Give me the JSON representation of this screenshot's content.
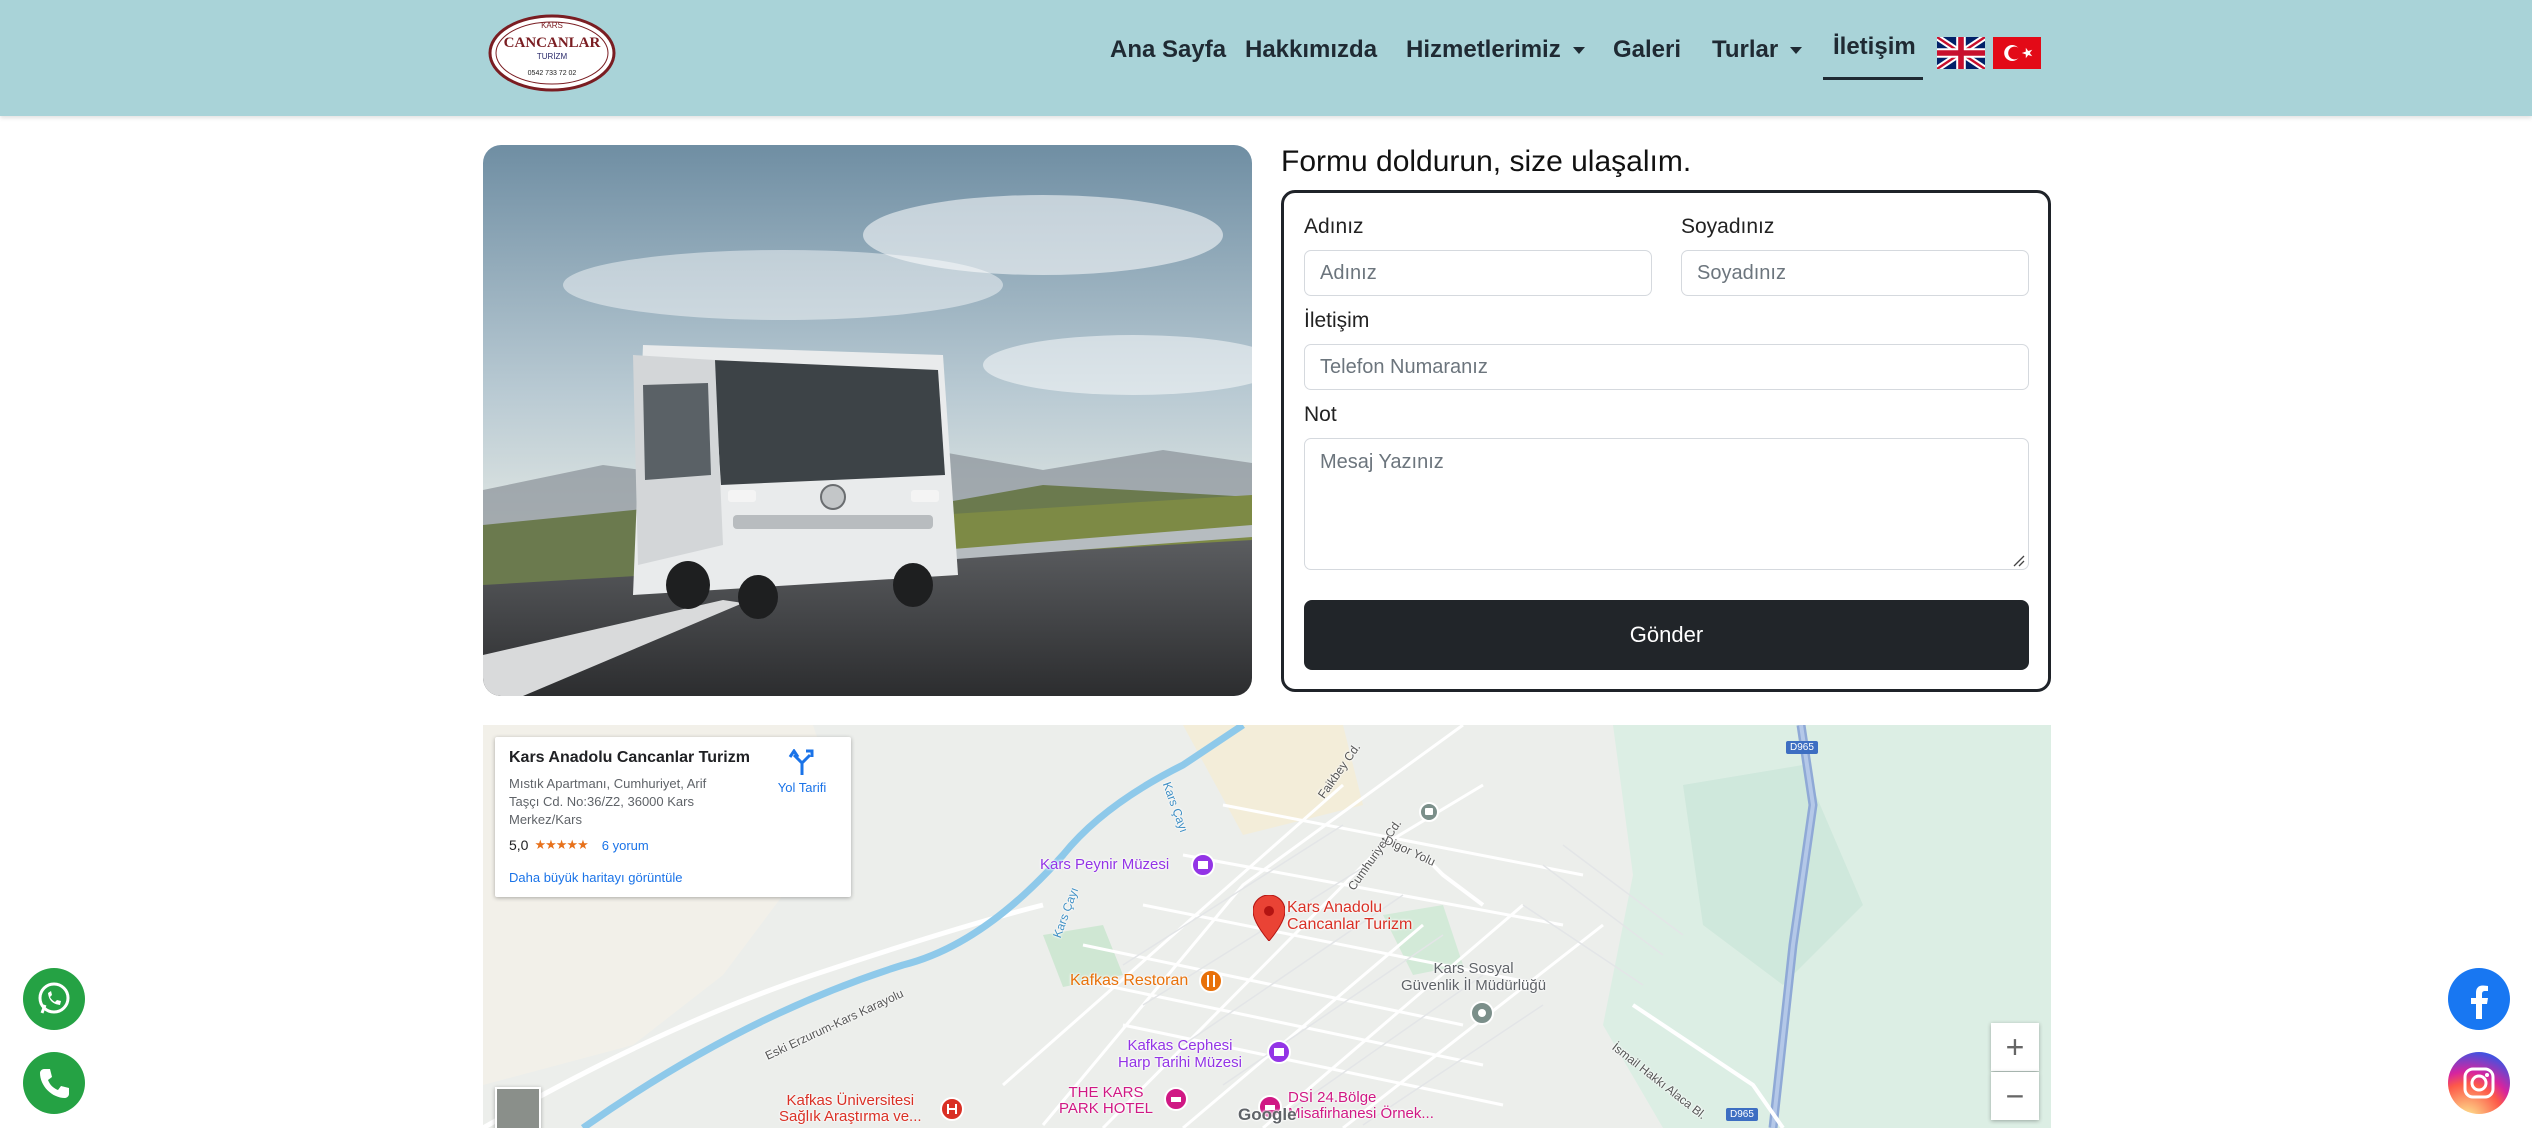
{
  "nav": {
    "items": [
      {
        "label": "Ana Sayfa"
      },
      {
        "label": "Hakkımızda"
      },
      {
        "label": "Hizmetlerimiz"
      },
      {
        "label": "Galeri"
      },
      {
        "label": "Turlar"
      },
      {
        "label": "İletişim"
      }
    ],
    "active": "İletişim"
  },
  "logo": {
    "top_text": "KARS",
    "main_text": "CANCANLAR",
    "sub_text": "TURİZM",
    "phone": "0542 733 72 02"
  },
  "form": {
    "title": "Formu doldurun, size ulaşalım.",
    "first_name_label": "Adınız",
    "first_name_placeholder": "Adınız",
    "last_name_label": "Soyadınız",
    "last_name_placeholder": "Soyadınız",
    "contact_label": "İletişim",
    "contact_placeholder": "Telefon Numaranız",
    "note_label": "Not",
    "note_placeholder": "Mesaj Yazınız",
    "submit_label": "Gönder"
  },
  "map": {
    "place_name": "Kars Anadolu Cancanlar Turizm",
    "address": "Mıstık Apartmanı, Cumhuriyet, Arif Taşçı Cd. No:36/Z2, 36000 Kars Merkez/Kars",
    "rating": "5,0",
    "stars": "★★★★★",
    "reviews": "6 yorum",
    "directions": "Yol Tarifi",
    "larger_map": "Daha büyük haritayı görüntüle",
    "marker_label_1": "Kars Anadolu",
    "marker_label_2": "Cancanlar Turizm",
    "zoom_in": "+",
    "zoom_out": "−",
    "google": "Google",
    "labels": {
      "museum": "Kars Peynir Müzesi",
      "restaurant": "Kafkas Restoran",
      "security_1": "Kars Sosyal",
      "security_2": "Güvenlik İl Müdürlüğü",
      "harp_1": "Kafkas Cephesi",
      "harp_2": "Harp Tarihi Müzesi",
      "hotel_1": "THE KARS",
      "hotel_2": "PARK HOTEL",
      "university": "Kafkas Üniversitesi",
      "university_2": "Sağlık Araştırma ve...",
      "dsi_1": "DSİ 24.Bölge",
      "dsi_2": "Misafirhanesi Örnek...",
      "river_1": "Kars Çayı",
      "river_2": "Kars Çayı",
      "road_1": "Eski Erzurum-Kars Karayolu",
      "road_2": "Faikbey Cd.",
      "road_3": "Cumhuriyet Cd.",
      "road_4": "Digor Yolu",
      "road_5": "İsmail Hakkı Alaca Bl.",
      "shield_1": "D965",
      "shield_2": "D965"
    }
  },
  "colors": {
    "navbar": "#a9d3d8",
    "button": "#212529",
    "whatsapp": "#25a244",
    "phone": "#25a244",
    "facebook": "#1877f2",
    "link": "#1a73e8"
  },
  "floating": [
    "whatsapp-icon",
    "phone-icon",
    "facebook-icon",
    "instagram-icon"
  ]
}
